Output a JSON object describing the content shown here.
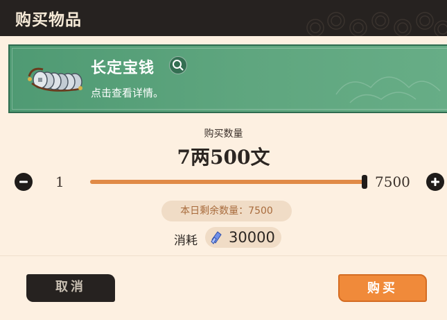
{
  "header": {
    "title": "购买物品"
  },
  "item": {
    "name": "长定宝钱",
    "description": "点击查看详情。",
    "icon": "coin-string-icon"
  },
  "quantity": {
    "label": "购买数量",
    "value_text": "7两500文",
    "min": "1",
    "max": "7500",
    "current": 7500,
    "range": [
      1,
      7500
    ]
  },
  "remaining": {
    "text": "本日剩余数量：7500"
  },
  "cost": {
    "label": "消耗",
    "value": "30000",
    "icon": "crystal-currency-icon"
  },
  "actions": {
    "cancel": "取消",
    "buy": "购买"
  },
  "colors": {
    "accent": "#f08a3a",
    "header_bg": "#262220",
    "item_card": "#5fa67f",
    "slider_fill": "#e08a46"
  }
}
